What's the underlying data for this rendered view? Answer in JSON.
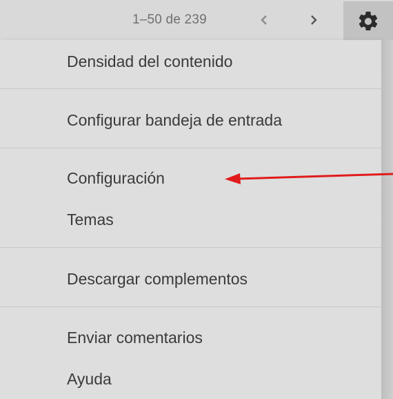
{
  "toolbar": {
    "page_info": "1–50 de 239",
    "prev_icon": "chevron-left-icon",
    "next_icon": "chevron-right-icon",
    "settings_icon": "gear-icon"
  },
  "menu": {
    "items": [
      {
        "label": "Densidad del contenido"
      },
      {
        "label": "Configurar bandeja de entrada"
      },
      {
        "label": "Configuración"
      },
      {
        "label": "Temas"
      },
      {
        "label": "Descargar complementos"
      },
      {
        "label": "Enviar comentarios"
      },
      {
        "label": "Ayuda"
      }
    ]
  },
  "annotation": {
    "arrow_color": "#e11b1b"
  }
}
